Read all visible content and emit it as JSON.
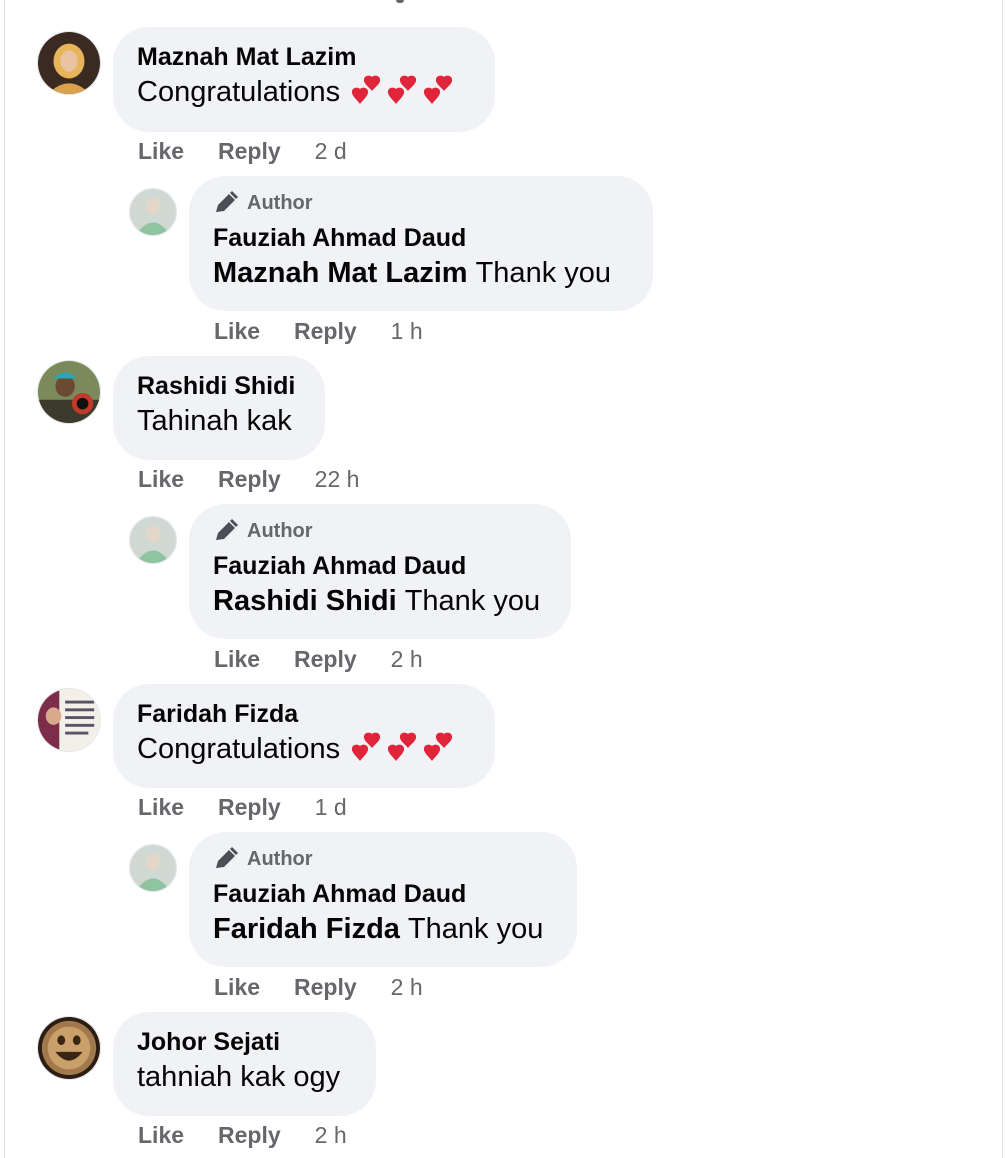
{
  "author_badge": "Author",
  "actions": {
    "like": "Like",
    "reply": "Reply"
  },
  "comments": [
    {
      "name": "Maznah Mat Lazim",
      "text": "Congratulations",
      "time": "2 d",
      "reply": {
        "name": "Fauziah Ahmad Daud",
        "mention": "Maznah Mat Lazim",
        "text": "Thank you",
        "time": "1 h"
      }
    },
    {
      "name": "Rashidi Shidi",
      "text": "Tahinah kak",
      "time": "22 h",
      "reply": {
        "name": "Fauziah Ahmad Daud",
        "mention": "Rashidi Shidi",
        "text": "Thank you",
        "time": "2 h"
      }
    },
    {
      "name": "Faridah Fizda",
      "text": "Congratulations",
      "time": "1 d",
      "reply": {
        "name": "Fauziah Ahmad Daud",
        "mention": "Faridah Fizda",
        "text": "Thank you",
        "time": "2 h"
      }
    },
    {
      "name": "Johor Sejati",
      "text": "tahniah kak ogy",
      "time": "2 h"
    }
  ],
  "colors": {
    "bubble": "#f0f2f5",
    "meta_text": "#65676b",
    "heart": "#e0243a"
  },
  "icons": {
    "author_badge": "pen-icon",
    "reaction": "two-hearts-emoji"
  }
}
